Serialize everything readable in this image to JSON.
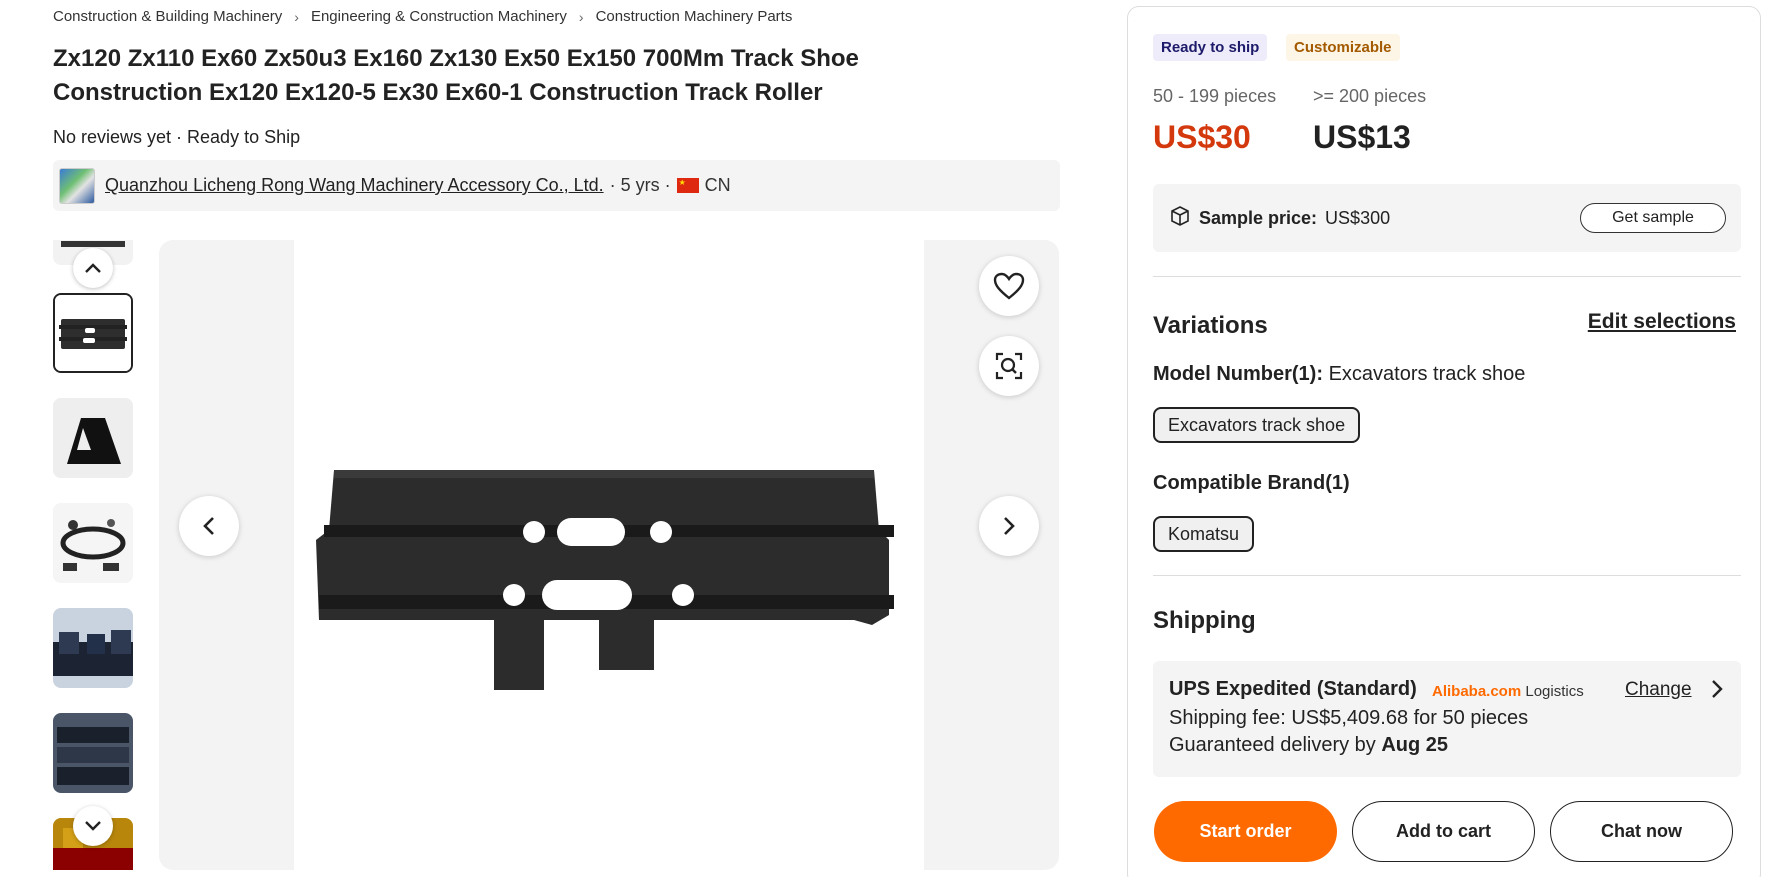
{
  "breadcrumb": {
    "items": [
      "Construction & Building Machinery",
      "Engineering & Construction Machinery",
      "Construction Machinery Parts"
    ]
  },
  "product": {
    "title": "Zx120 Zx110 Ex60 Zx50u3 Ex160 Zx130 Ex50 Ex150 700Mm Track Shoe Construction Ex120 Ex120-5 Ex30 Ex60-1 Construction Track Roller",
    "meta": "No reviews yet · Ready to Ship"
  },
  "supplier": {
    "name": "Quanzhou Licheng Rong Wang Machinery Accessory Co., Ltd.",
    "years": "· 5 yrs ·",
    "country": "CN"
  },
  "gallery": {
    "icons": {
      "up": "chevron-up-icon",
      "down": "chevron-down-icon",
      "prev": "chevron-left-icon",
      "next": "chevron-right-icon",
      "favorite": "heart-icon",
      "search": "image-search-icon"
    }
  },
  "panel": {
    "badges": {
      "ready": "Ready to ship",
      "custom": "Customizable"
    },
    "tiers": [
      {
        "label": "50 - 199 pieces",
        "price": "US$30"
      },
      {
        "label": ">= 200 pieces",
        "price": "US$13"
      }
    ],
    "sample": {
      "label": "Sample price:",
      "price": "US$300",
      "button": "Get sample"
    },
    "variations": {
      "title": "Variations",
      "edit": "Edit selections",
      "model_label": "Model Number(1):",
      "model_value": "Excavators track shoe",
      "model_chip": "Excavators track shoe",
      "brand_label": "Compatible Brand(1)",
      "brand_chip": "Komatsu"
    },
    "shipping": {
      "title": "Shipping",
      "method": "UPS Expedited (Standard)",
      "logistics_brand": "Alibaba.com",
      "logistics_text": "Logistics",
      "change": "Change",
      "fee": "Shipping fee: US$5,409.68 for 50 pieces",
      "delivery_prefix": "Guaranteed delivery by",
      "delivery_date": "Aug 25"
    },
    "actions": {
      "start": "Start order",
      "cart": "Add to cart",
      "chat": "Chat now"
    }
  },
  "colors": {
    "accent": "#ff6a00",
    "price_red": "#d4380d",
    "text": "#222222"
  }
}
